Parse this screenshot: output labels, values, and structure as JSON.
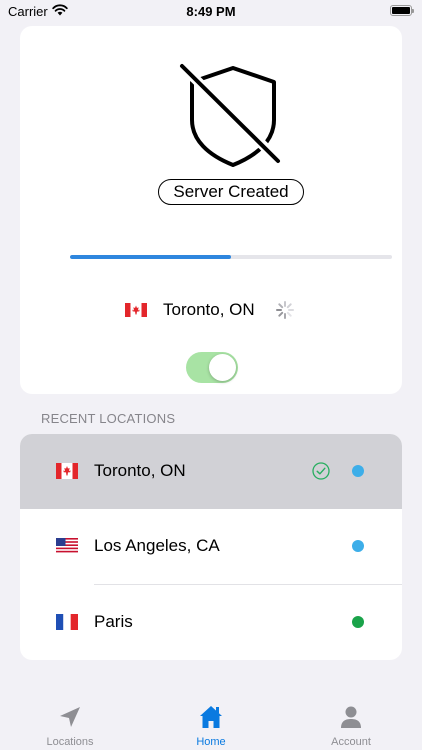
{
  "status_bar": {
    "carrier": "Carrier",
    "time": "8:49 PM"
  },
  "connection": {
    "status": "Server Created",
    "progress": 0.5,
    "location": "Toronto, ON",
    "location_flag": "canada-flag",
    "toggle_on": true,
    "toggle_color": "#a8e3a4",
    "progress_color": "#2e86de"
  },
  "recent": {
    "header": "RECENT LOCATIONS",
    "items": [
      {
        "label": "Toronto, ON",
        "flag": "canada-flag",
        "selected": true,
        "checked": true,
        "dot_color": "#3daee9"
      },
      {
        "label": "Los Angeles, CA",
        "flag": "usa-flag",
        "selected": false,
        "checked": false,
        "dot_color": "#3daee9"
      },
      {
        "label": "Paris",
        "flag": "france-flag",
        "selected": false,
        "checked": false,
        "dot_color": "#1aa34a"
      }
    ]
  },
  "tabs": [
    {
      "label": "Locations",
      "icon": "location-arrow-icon",
      "active": false
    },
    {
      "label": "Home",
      "icon": "house-icon",
      "active": true
    },
    {
      "label": "Account",
      "icon": "person-icon",
      "active": false
    }
  ]
}
